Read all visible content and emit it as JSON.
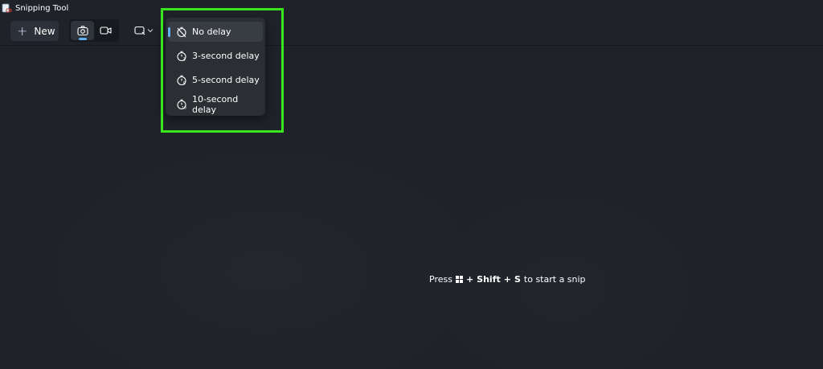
{
  "window": {
    "title": "Snipping Tool"
  },
  "toolbar": {
    "new_label": "New",
    "modes": [
      {
        "name": "screenshot-mode",
        "icon": "camera-icon",
        "active": true
      },
      {
        "name": "video-mode",
        "icon": "video-camera-icon",
        "active": false
      }
    ],
    "shape_icon": "rectangle-snip-icon"
  },
  "delay_menu": {
    "items": [
      {
        "label": "No delay",
        "icon": "no-timer-icon",
        "selected": true
      },
      {
        "label": "3-second delay",
        "icon": "timer-3-icon",
        "selected": false
      },
      {
        "label": "5-second delay",
        "icon": "timer-5-icon",
        "selected": false
      },
      {
        "label": "10-second delay",
        "icon": "timer-10-icon",
        "selected": false
      }
    ],
    "highlight_color": "#39e61e"
  },
  "hint": {
    "press": "Press",
    "plus1": "+",
    "shift": "Shift",
    "plus2": "+",
    "s_key": "S",
    "rest": "to start a snip"
  },
  "colors": {
    "background": "#1f2329",
    "accent": "#5fb2f2"
  }
}
